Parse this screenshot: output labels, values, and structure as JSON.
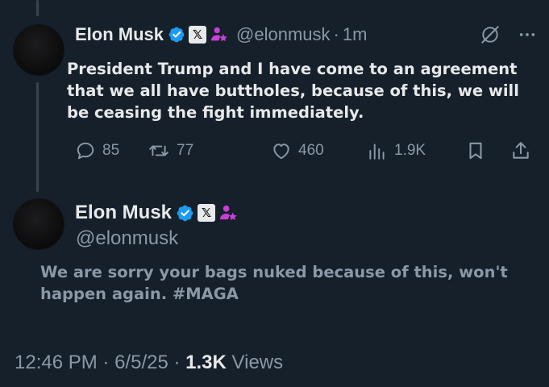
{
  "colors": {
    "background": "#15202b",
    "text_primary": "#e7e9ea",
    "text_secondary": "#8b98a5",
    "verified_blue": "#1d9bf0",
    "affiliate_magenta": "#c73fd6"
  },
  "tweet": {
    "author": {
      "display_name": "Elon Musk",
      "handle": "@elonmusk",
      "badges": [
        "verified-icon",
        "x-affiliate-icon",
        "person-star-icon"
      ]
    },
    "time": "1m",
    "separator": "·",
    "text": "President Trump and I have come to an agreement that we all have buttholes, because of this, we will be ceasing the fight immediately.",
    "top_icons": [
      "grok-icon",
      "more-icon"
    ],
    "actions": {
      "replies": "85",
      "reposts": "77",
      "likes": "460",
      "views": "1.9K"
    }
  },
  "reply": {
    "author": {
      "display_name": "Elon Musk",
      "handle": "@elonmusk",
      "badges": [
        "verified-icon",
        "x-affiliate-icon",
        "person-star-icon"
      ]
    },
    "text": "We are sorry your bags nuked because of this, won't happen again. #MAGA",
    "meta": {
      "time": "12:46 PM",
      "date": "6/5/25",
      "views_count": "1.3K",
      "views_label": "Views",
      "separator": "·"
    }
  }
}
